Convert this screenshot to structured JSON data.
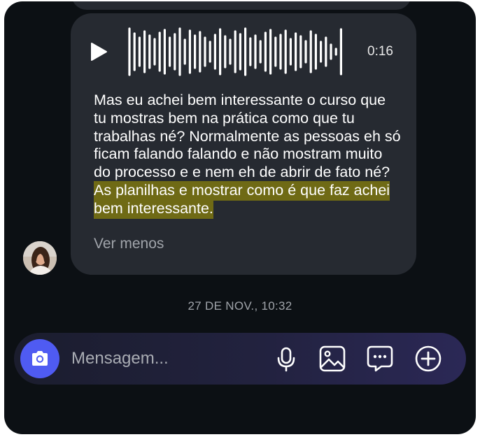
{
  "message": {
    "audio_duration": "0:16",
    "transcript_plain": "Mas eu achei bem interessante o curso que tu mostras bem na prática como que tu trabalhas né? Normalmente as pessoas eh só ficam falando falando e não mostram muito do processo e e nem eh de abrir de fato né? ",
    "transcript_highlight": "As planilhas e mostrar como é que faz achei bem interessante.",
    "see_less_label": "Ver menos"
  },
  "timestamp": "27 DE NOV., 10:32",
  "composer": {
    "placeholder": "Mensagem..."
  },
  "icons": {
    "play": "play-icon",
    "camera": "camera-icon",
    "mic": "microphone-icon",
    "gallery": "image-icon",
    "sticker": "sticker-icon",
    "plus": "plus-circle-icon"
  },
  "colors": {
    "background": "#0c1014",
    "bubble": "#262a31",
    "highlight": "#6f6a15",
    "camera_button": "#4f5bf2"
  }
}
